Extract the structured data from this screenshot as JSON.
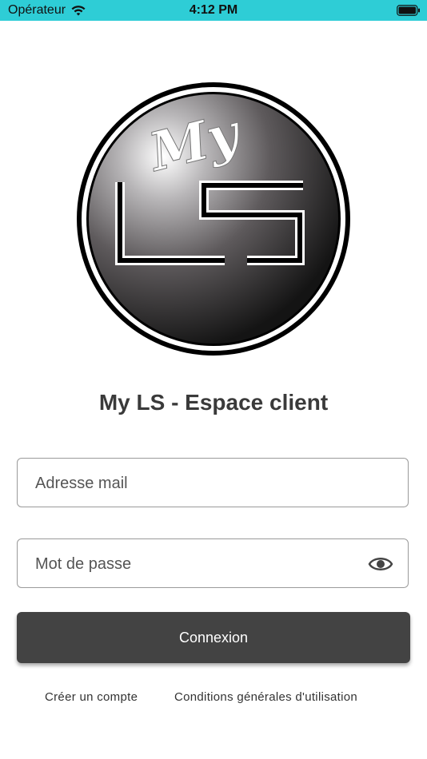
{
  "status_bar": {
    "carrier": "Opérateur",
    "time": "4:12 PM",
    "color": "#2ecdd6"
  },
  "icons": {
    "wifi": "wifi-icon",
    "battery": "battery-icon",
    "eye": "eye-icon"
  },
  "logo": {
    "script_text": "My",
    "letters": "LS"
  },
  "page_title": "My LS - Espace client",
  "form": {
    "email_placeholder": "Adresse mail",
    "password_placeholder": "Mot de passe",
    "login_label": "Connexion",
    "button_color": "#434343"
  },
  "links": {
    "create_account": "Créer un compte",
    "terms": "Conditions générales d'utilisation"
  }
}
